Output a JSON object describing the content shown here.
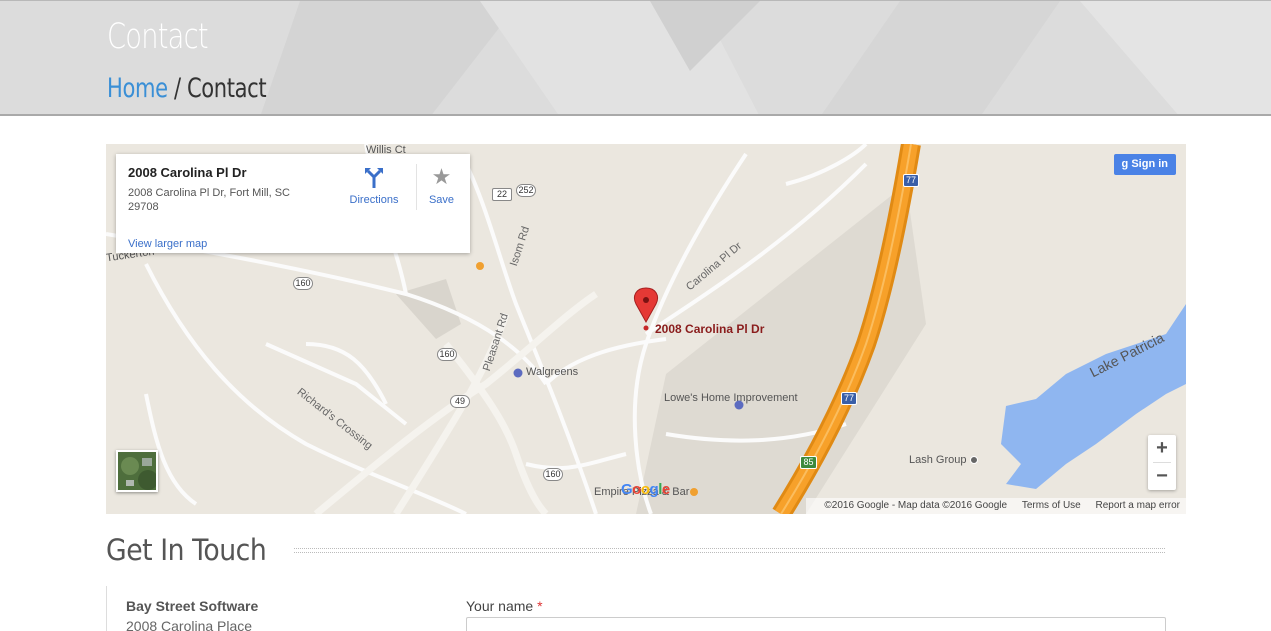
{
  "header": {
    "title": "Contact",
    "breadcrumb": {
      "home": "Home",
      "separator": "/",
      "current": "Contact"
    }
  },
  "map": {
    "place_card": {
      "title": "2008 Carolina Pl Dr",
      "address": "2008 Carolina Pl Dr, Fort Mill, SC 29708",
      "view_larger": "View larger map",
      "directions": "Directions",
      "save": "Save"
    },
    "sign_in": "Sign in",
    "pin_label": "2008 Carolina Pl Dr",
    "labels": {
      "willis_ct": "Willis Ct",
      "tuckerton": "Tuckerton",
      "isom_rd": "Isom Rd",
      "pleasant_rd": "Pleasant Rd",
      "carolina_pl_dr": "Carolina Pl Dr",
      "walgreens": "Walgreens",
      "lowes": "Lowe's Home Improvement",
      "richards_crossing": "Richard's Crossing",
      "lash_group": "Lash Group",
      "lake_patricia": "Lake Patricia",
      "empire_pizza": "Empire Pizza & Bar"
    },
    "shields": {
      "r22": "22",
      "r252": "252",
      "r160a": "160",
      "r160b": "160",
      "r160c": "160",
      "r49": "49",
      "i77a": "77",
      "i77b": "77",
      "r85": "85"
    },
    "google": "Google",
    "footer": {
      "copyright": "©2016 Google - Map data ©2016 Google",
      "terms": "Terms of Use",
      "report": "Report a map error"
    },
    "zoom_in": "+",
    "zoom_out": "−",
    "colors": {
      "highway": "#f7a12a",
      "water": "#8fb6f0",
      "pin": "#e53935"
    }
  },
  "contact": {
    "section_title": "Get In Touch",
    "company": "Bay Street Software",
    "street": "2008 Carolina Place",
    "form": {
      "name_label": "Your name",
      "required_mark": "*",
      "name_value": ""
    }
  }
}
